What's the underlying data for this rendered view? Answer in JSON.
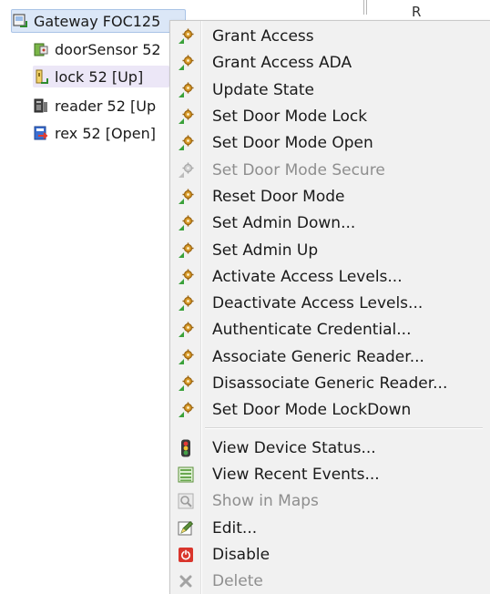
{
  "tree": {
    "gateway_label": "Gateway FOC125",
    "children": [
      {
        "label": "doorSensor 52",
        "icon": "door-sensor-icon"
      },
      {
        "label": "lock 52 [Up]",
        "icon": "lock-icon"
      },
      {
        "label": "reader 52 [Up",
        "icon": "card-reader-icon"
      },
      {
        "label": "rex 52 [Open]",
        "icon": "rex-exit-icon"
      }
    ]
  },
  "right_panel": {
    "header_fragment": "R"
  },
  "context_menu": {
    "command_items": [
      {
        "label": "Grant Access",
        "enabled": true
      },
      {
        "label": "Grant Access ADA",
        "enabled": true
      },
      {
        "label": "Update State",
        "enabled": true
      },
      {
        "label": "Set Door Mode Lock",
        "enabled": true
      },
      {
        "label": "Set Door Mode Open",
        "enabled": true
      },
      {
        "label": "Set Door Mode Secure",
        "enabled": false
      },
      {
        "label": "Reset Door Mode",
        "enabled": true
      },
      {
        "label": "Set Admin Down...",
        "enabled": true
      },
      {
        "label": "Set Admin Up",
        "enabled": true
      },
      {
        "label": "Activate Access Levels...",
        "enabled": true
      },
      {
        "label": "Deactivate Access Levels...",
        "enabled": true
      },
      {
        "label": "Authenticate Credential...",
        "enabled": true
      },
      {
        "label": "Associate Generic Reader...",
        "enabled": true
      },
      {
        "label": "Disassociate Generic Reader...",
        "enabled": true
      },
      {
        "label": "Set Door Mode LockDown",
        "enabled": true
      }
    ],
    "device_items": [
      {
        "label": "View Device Status...",
        "icon": "traffic-light-icon",
        "enabled": true
      },
      {
        "label": "View Recent Events...",
        "icon": "event-list-icon",
        "enabled": true
      },
      {
        "label": "Show in Maps",
        "icon": "map-magnifier-icon",
        "enabled": false
      },
      {
        "label": "Edit...",
        "icon": "edit-pencil-icon",
        "enabled": true
      },
      {
        "label": "Disable",
        "icon": "power-icon",
        "enabled": true
      },
      {
        "label": "Delete",
        "icon": "delete-x-icon",
        "enabled": false
      }
    ]
  },
  "colors": {
    "menu_background": "#f1f1f1",
    "disabled_text": "#8e8e8e",
    "selection_background": "#dbe7f7",
    "command_gear": "#d89a2a",
    "command_arrow": "#3aa13a"
  }
}
